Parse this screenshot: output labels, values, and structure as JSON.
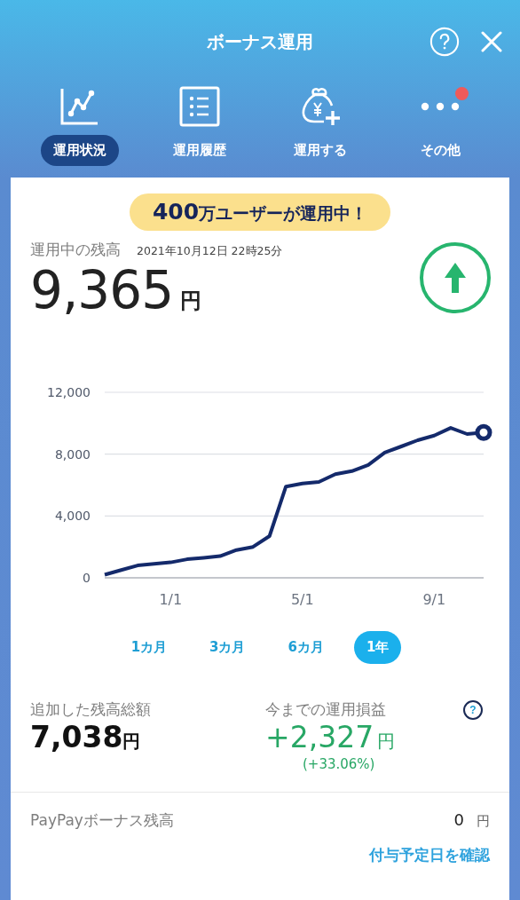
{
  "header": {
    "title": "ボーナス運用"
  },
  "tabs": [
    {
      "label": "運用状況",
      "kind": "chart",
      "selected": true,
      "badge": false
    },
    {
      "label": "運用履歴",
      "kind": "list",
      "selected": false,
      "badge": false
    },
    {
      "label": "運用する",
      "kind": "bag",
      "selected": false,
      "badge": false
    },
    {
      "label": "その他",
      "kind": "more",
      "selected": false,
      "badge": true
    }
  ],
  "banner": {
    "count": "400",
    "text": "万ユーザーが運用中！"
  },
  "balance": {
    "label": "運用中の残高",
    "timestamp": "2021年10月12日 22時25分",
    "amount": "9,365",
    "unit": "円"
  },
  "chart": {
    "chart_data": {
      "type": "line",
      "categories": [
        null,
        null,
        null,
        null,
        "1/1",
        null,
        null,
        null,
        null,
        null,
        null,
        null,
        "5/1",
        null,
        null,
        null,
        null,
        null,
        null,
        null,
        "9/1",
        null,
        null,
        null
      ],
      "yticks": [
        {
          "value": 0,
          "label": "0"
        },
        {
          "value": 4000,
          "label": "4,000"
        },
        {
          "value": 8000,
          "label": "8,000"
        },
        {
          "value": 12000,
          "label": "12,000"
        }
      ],
      "ylim": [
        0,
        12000
      ],
      "series": [
        {
          "color": "#142a6b",
          "values": [
            200,
            500,
            800,
            900,
            1000,
            1200,
            1300,
            1400,
            1800,
            2000,
            2700,
            5900,
            6100,
            6200,
            6700,
            6900,
            7300,
            8100,
            8500,
            8900,
            9200,
            9700,
            9300,
            9400
          ]
        }
      ]
    }
  },
  "periods": [
    {
      "label": "1カ月",
      "selected": false
    },
    {
      "label": "3カ月",
      "selected": false
    },
    {
      "label": "6カ月",
      "selected": false
    },
    {
      "label": "1年",
      "selected": true
    }
  ],
  "added": {
    "label": "追加した残高総額",
    "amount": "7,038",
    "unit": "円"
  },
  "profit": {
    "label": "今までの運用損益",
    "amount": "+2,327",
    "unit": "円",
    "percent": "(+33.06%)",
    "help": "?"
  },
  "bonus": {
    "label": "PayPayボーナス残高",
    "amount": "0",
    "unit": "円",
    "link": "付与予定日を確認"
  }
}
